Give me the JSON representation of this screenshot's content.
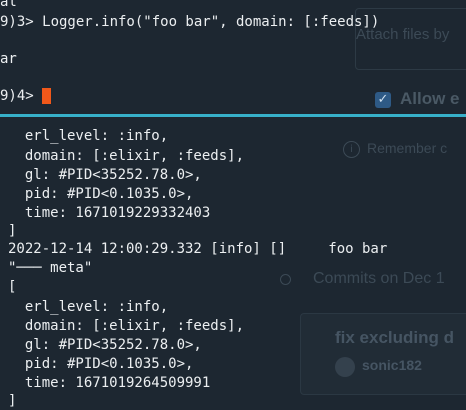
{
  "background_page": {
    "attach_text": "Attach files by",
    "allow_text": "Allow e",
    "remember_text": "Remember c",
    "commits_text": "Commits on Dec 1",
    "commit_title": "fix excluding d",
    "commit_author": "sonic182",
    "info_icon": "info-icon",
    "check_icon": "checkmark-icon"
  },
  "terminal_top": {
    "lines": [
      "al",
      "9)3> Logger.info(\"foo bar\", domain: [:feeds])",
      "ar",
      "9)4> "
    ]
  },
  "terminal_bottom": {
    "lines": [
      "  erl_level: :info,",
      "  domain: [:elixir, :feeds],",
      "  gl: #PID<35252.78.0>,",
      "  pid: #PID<0.1035.0>,",
      "  time: 1671019229332403",
      "]",
      "2022-12-14 12:00:29.332 [info] []     foo bar",
      "\"─── meta\"",
      "[",
      "  erl_level: :info,",
      "  domain: [:elixir, :feeds],",
      "  gl: #PID<35252.78.0>,",
      "  pid: #PID<0.1035.0>,",
      "  time: 1671019264509991",
      "]"
    ]
  },
  "colors": {
    "terminal_bg": "#1d2731",
    "divider": "#37b0c9",
    "cursor": "#f0581a",
    "text": "#eceff1"
  }
}
